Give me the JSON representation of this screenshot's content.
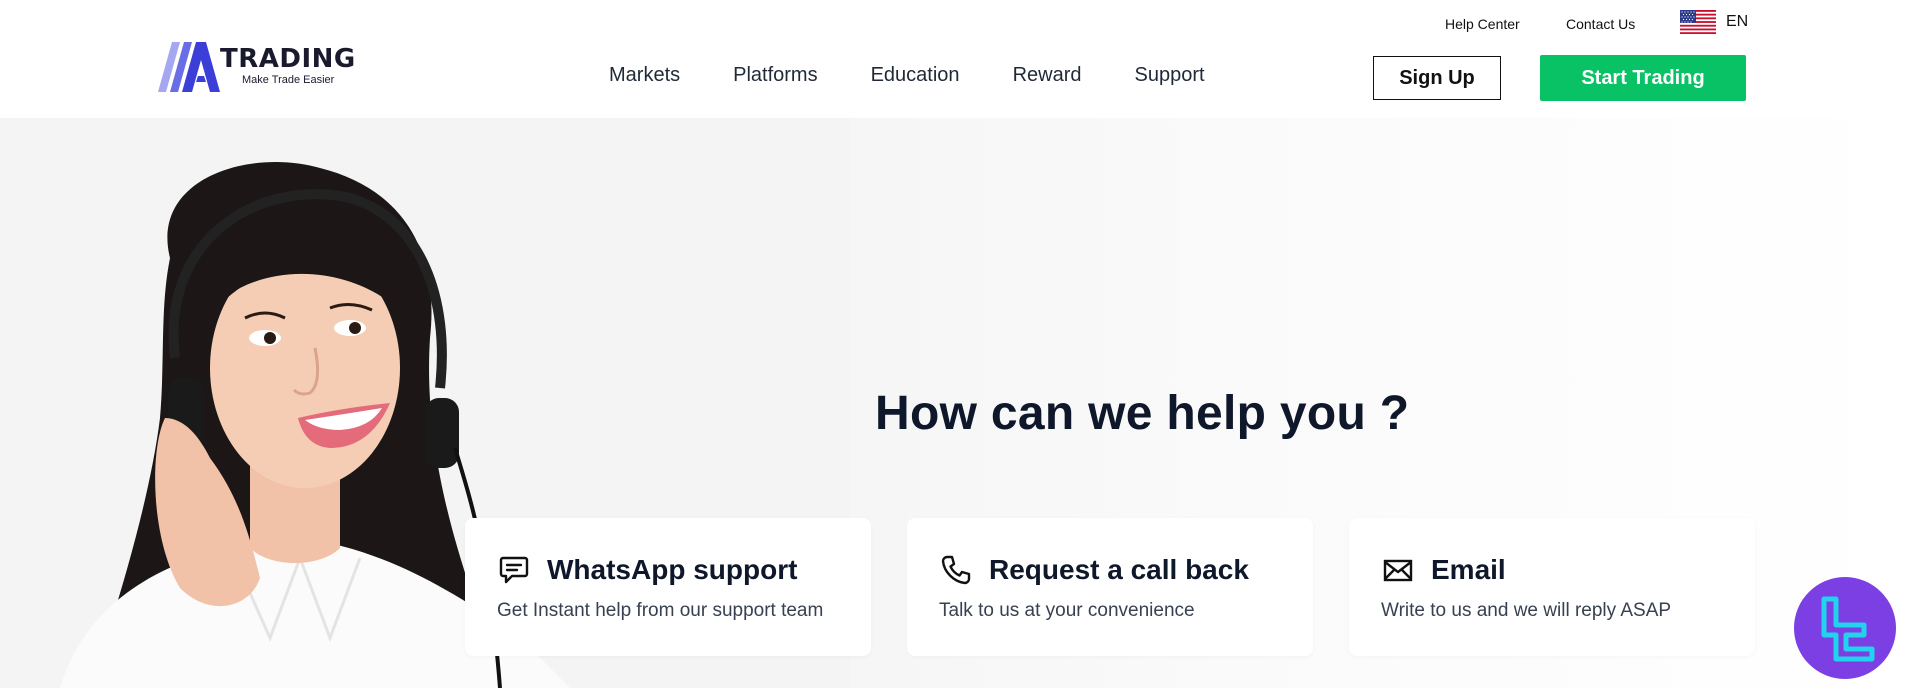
{
  "utility": {
    "help_center": "Help Center",
    "contact_us": "Contact Us",
    "language": "EN",
    "flag_icon": "us-flag-icon"
  },
  "brand": {
    "name": "TRADING",
    "tagline": "Make Trade Easier"
  },
  "nav": {
    "items": [
      {
        "label": "Markets"
      },
      {
        "label": "Platforms"
      },
      {
        "label": "Education"
      },
      {
        "label": "Reward"
      },
      {
        "label": "Support"
      }
    ]
  },
  "actions": {
    "sign_up": "Sign Up",
    "start_trading": "Start Trading"
  },
  "hero": {
    "title": "How can we help you ?"
  },
  "cards": [
    {
      "title": "WhatsApp support",
      "description": "Get Instant help from our support team",
      "icon": "chat-icon"
    },
    {
      "title": "Request a call back",
      "description": "Talk to us at your convenience",
      "icon": "phone-icon"
    },
    {
      "title": "Email",
      "description": "Write to us and we will reply ASAP",
      "icon": "mail-icon"
    }
  ],
  "colors": {
    "primary_green": "#0ac266",
    "logo_blue": "#3b3fd8",
    "badge_purple": "#7b3fe4",
    "badge_cyan": "#22d3ee",
    "text_dark": "#0f172a"
  }
}
